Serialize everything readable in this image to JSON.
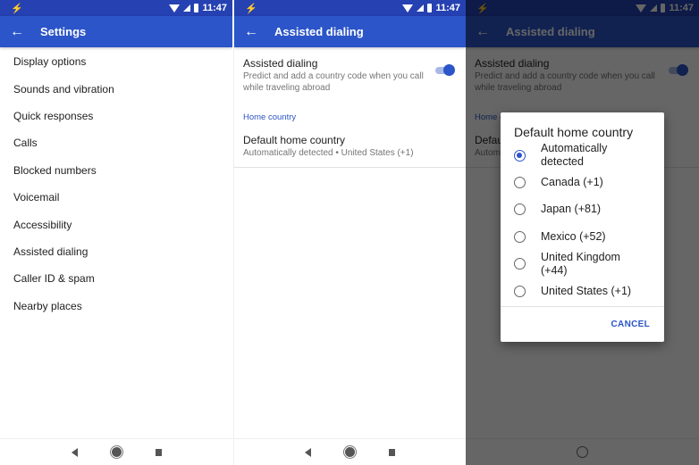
{
  "status_bar": {
    "time": "11:47"
  },
  "screen_settings": {
    "title": "Settings",
    "items": [
      "Display options",
      "Sounds and vibration",
      "Quick responses",
      "Calls",
      "Blocked numbers",
      "Voicemail",
      "Accessibility",
      "Assisted dialing",
      "Caller ID & spam",
      "Nearby places"
    ]
  },
  "screen_assisted": {
    "title": "Assisted dialing",
    "toggle_pref": {
      "title": "Assisted dialing",
      "summary": "Predict and add a country code when you call while traveling abroad",
      "enabled": true
    },
    "section_header": "Home country",
    "home_pref": {
      "title": "Default home country",
      "summary": "Automatically detected • United States (+1)"
    }
  },
  "dialog": {
    "title": "Default home country",
    "options": [
      {
        "label": "Automatically detected",
        "selected": true
      },
      {
        "label": "Canada (+1)",
        "selected": false
      },
      {
        "label": "Japan (+81)",
        "selected": false
      },
      {
        "label": "Mexico (+52)",
        "selected": false
      },
      {
        "label": "United Kingdom (+44)",
        "selected": false
      },
      {
        "label": "United States (+1)",
        "selected": false
      }
    ],
    "cancel_label": "CANCEL"
  },
  "colors": {
    "primary": "#2b55c8",
    "status_bar": "#2541b2"
  }
}
